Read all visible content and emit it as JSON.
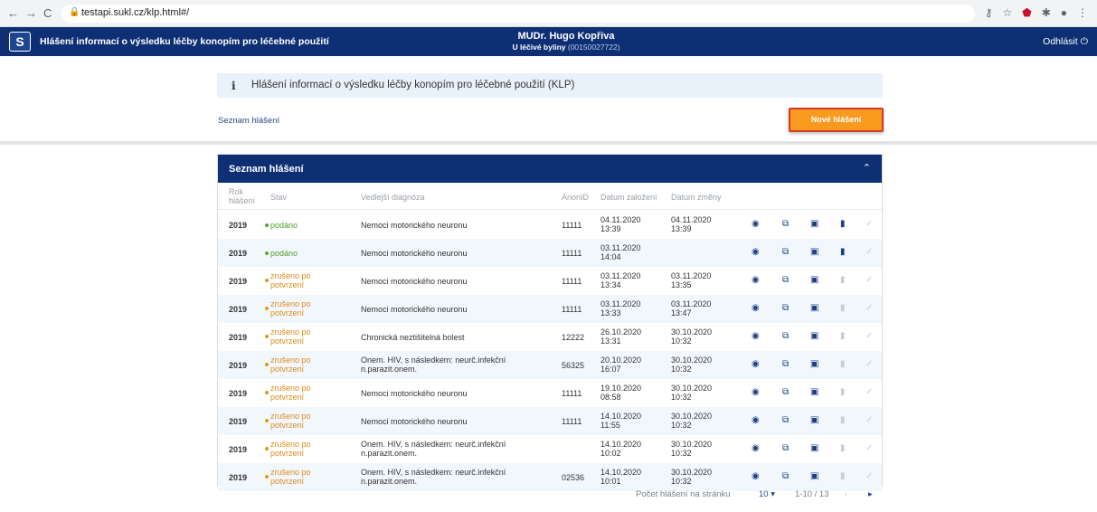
{
  "browser": {
    "url": "testapi.sukl.cz/klp.html#/",
    "back_icon": "arrow-left-icon",
    "forward_icon": "arrow-right-icon",
    "reload_icon": "reload-icon"
  },
  "header": {
    "logo_text": "S",
    "title": "Hlášení informací o výsledku léčby konopím pro léčebné použití",
    "user_name": "MUDr. Hugo Kopřiva",
    "pharmacy_name": "U léčivé byliny",
    "pharmacy_code": "(00150027722)",
    "logout_label": "Odhlásit"
  },
  "info": {
    "icon": "i",
    "text": "Hlášení informací o výsledku léčby konopím pro léčebné použití (KLP)"
  },
  "breadcrumb": "Seznam hlášení",
  "new_button_label": "Nové hlášení",
  "panel": {
    "title": "Seznam hlášení",
    "columns": {
      "year_line1": "Rok",
      "year_line2": "hlášení",
      "status": "Stav",
      "diagnosis": "Vedlejší diagnóza",
      "anon_id": "AnonID",
      "created": "Datum založení",
      "changed": "Datum změny"
    }
  },
  "rows": [
    {
      "year": "2019",
      "status1": "podáno",
      "status2": "",
      "dx1": "Nemoci motorického neuronu",
      "dx2": "",
      "anon": "11111",
      "created1": "04.11.2020",
      "created2": "13:39",
      "changed1": "04.11.2020",
      "changed2": "13:39"
    },
    {
      "year": "2019",
      "status1": "podáno",
      "status2": "",
      "dx1": "Nemoci motorického neuronu",
      "dx2": "",
      "anon": "11111",
      "created1": "03.11.2020",
      "created2": "14:04",
      "changed1": "",
      "changed2": ""
    },
    {
      "year": "2019",
      "status1": "zrušeno po",
      "status2": "potvrzení",
      "dx1": "Nemoci motorického neuronu",
      "dx2": "",
      "anon": "11111",
      "created1": "03.11.2020",
      "created2": "13:34",
      "changed1": "03.11.2020",
      "changed2": "13:35"
    },
    {
      "year": "2019",
      "status1": "zrušeno po",
      "status2": "potvrzení",
      "dx1": "Nemoci motorického neuronu",
      "dx2": "",
      "anon": "11111",
      "created1": "03.11.2020",
      "created2": "13:33",
      "changed1": "03.11.2020",
      "changed2": "13:47"
    },
    {
      "year": "2019",
      "status1": "zrušeno po",
      "status2": "potvrzení",
      "dx1": "Chronická neztišitelná bolest",
      "dx2": "",
      "anon": "12222",
      "created1": "26.10.2020",
      "created2": "13:31",
      "changed1": "30.10.2020",
      "changed2": "10:32"
    },
    {
      "year": "2019",
      "status1": "zrušeno po",
      "status2": "potvrzení",
      "dx1": "Onem. HIV, s následkem: neurč.infekční",
      "dx2": "n.parazit.onem.",
      "anon": "56325",
      "created1": "20.10.2020",
      "created2": "16:07",
      "changed1": "30.10.2020",
      "changed2": "10:32"
    },
    {
      "year": "2019",
      "status1": "zrušeno po",
      "status2": "potvrzení",
      "dx1": "Nemoci motorického neuronu",
      "dx2": "",
      "anon": "11111",
      "created1": "19.10.2020",
      "created2": "08:58",
      "changed1": "30.10.2020",
      "changed2": "10:32"
    },
    {
      "year": "2019",
      "status1": "zrušeno po",
      "status2": "potvrzení",
      "dx1": "Nemoci motorického neuronu",
      "dx2": "",
      "anon": "11111",
      "created1": "14.10.2020",
      "created2": "11:55",
      "changed1": "30.10.2020",
      "changed2": "10:32"
    },
    {
      "year": "2019",
      "status1": "zrušeno po",
      "status2": "potvrzení",
      "dx1": "Onem. HIV, s následkem: neurč.infekční",
      "dx2": "n.parazit.onem.",
      "anon": "",
      "created1": "14.10.2020",
      "created2": "10:02",
      "changed1": "30.10.2020",
      "changed2": "10:32"
    },
    {
      "year": "2019",
      "status1": "zrušeno po",
      "status2": "potvrzení",
      "dx1": "Onem. HIV, s následkem: neurč.infekční",
      "dx2": "n.parazit.onem.",
      "anon": "02536",
      "created1": "14.10.2020",
      "created2": "10:01",
      "changed1": "30.10.2020",
      "changed2": "10:32"
    }
  ],
  "pagination": {
    "per_page_label": "Počet hlášení na stránku",
    "per_page_value": "10",
    "range": "1-10 / 13"
  },
  "colors": {
    "brand_navy": "#0e2f74",
    "accent_orange": "#f79a1d",
    "status_submitted": "#4f9a2b",
    "status_cancelled": "#de8a1c"
  }
}
